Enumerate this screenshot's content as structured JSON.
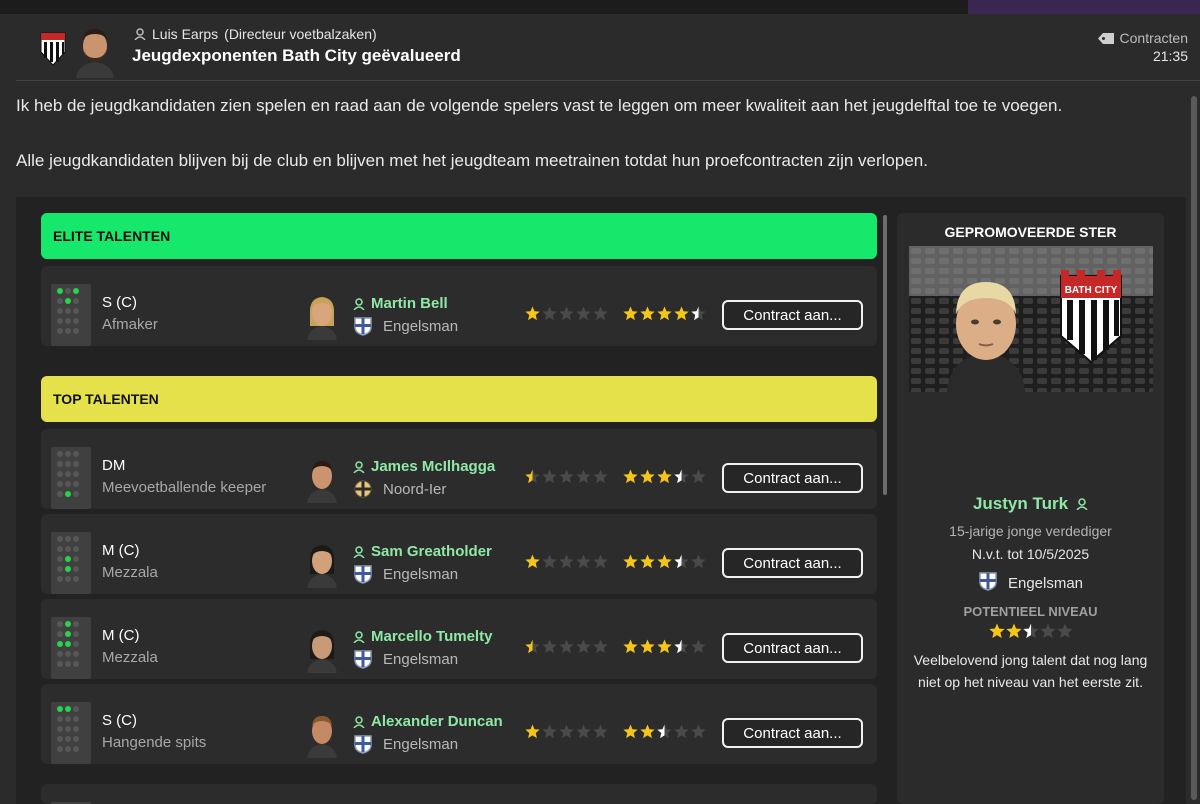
{
  "header": {
    "sender_name": "Luis Earps",
    "sender_role": "(Directeur voetbalzaken)",
    "subject": "Jeugdexponenten Bath City geëvalueerd",
    "category": "Contracten",
    "time": "21:35"
  },
  "body": {
    "para1": "Ik heb de jeugdkandidaten zien spelen en raad aan de volgende spelers vast te leggen om meer kwaliteit aan het jeugdelftal toe te voegen.",
    "para2": "Alle jeugdkandidaten blijven bij de club en blijven met het jeugdteam meetrainen totdat hun proefcontracten zijn verlopen."
  },
  "sections": {
    "elite": "ELITE TALENTEN",
    "top": "TOP TALENTEN"
  },
  "players": [
    {
      "position": "S (C)",
      "role": "Afmaker",
      "name": "Martin Bell",
      "nationality": "Engelsman",
      "flag": "england-flag-icon",
      "current_ability_stars": 1,
      "potential_ability_stars": 4.5,
      "contract_label": "Contract aan..."
    },
    {
      "position": "DM",
      "role": "Meevoetballende keeper",
      "name": "James McIlhagga",
      "nationality": "Noord-Ier",
      "flag": "northern-ireland-flag-icon",
      "current_ability_stars": 0.5,
      "potential_ability_stars": 3.5,
      "contract_label": "Contract aan..."
    },
    {
      "position": "M (C)",
      "role": "Mezzala",
      "name": "Sam Greatholder",
      "nationality": "Engelsman",
      "flag": "england-flag-icon",
      "current_ability_stars": 1,
      "potential_ability_stars": 3.5,
      "contract_label": "Contract aan..."
    },
    {
      "position": "M (C)",
      "role": "Mezzala",
      "name": "Marcello Tumelty",
      "nationality": "Engelsman",
      "flag": "england-flag-icon",
      "current_ability_stars": 0.5,
      "potential_ability_stars": 3.5,
      "contract_label": "Contract aan..."
    },
    {
      "position": "S (C)",
      "role": "Hangende spits",
      "name": "Alexander Duncan",
      "nationality": "Engelsman",
      "flag": "england-flag-icon",
      "current_ability_stars": 1,
      "potential_ability_stars": 2.5,
      "contract_label": "Contract aan..."
    }
  ],
  "promoted_star": {
    "title": "GEPROMOVEERDE STER",
    "name": "Justyn Turk",
    "description": "15-jarige jonge verdediger",
    "contract": "N.v.t. tot 10/5/2025",
    "nationality": "Engelsman",
    "potential_label": "POTENTIEEL NIVEAU",
    "potential_stars": 2.5,
    "comment": "Veelbelovend jong talent dat nog lang niet op het niveau van het eerste zit."
  },
  "badge_text": "BATH CITY",
  "colors": {
    "elite_bar": "#16e86b",
    "top_bar": "#e4e14a",
    "name_green": "#8fe8a5",
    "star_gold": "#f5c518",
    "star_white": "#ffffff",
    "star_empty": "#4a4a4a"
  }
}
